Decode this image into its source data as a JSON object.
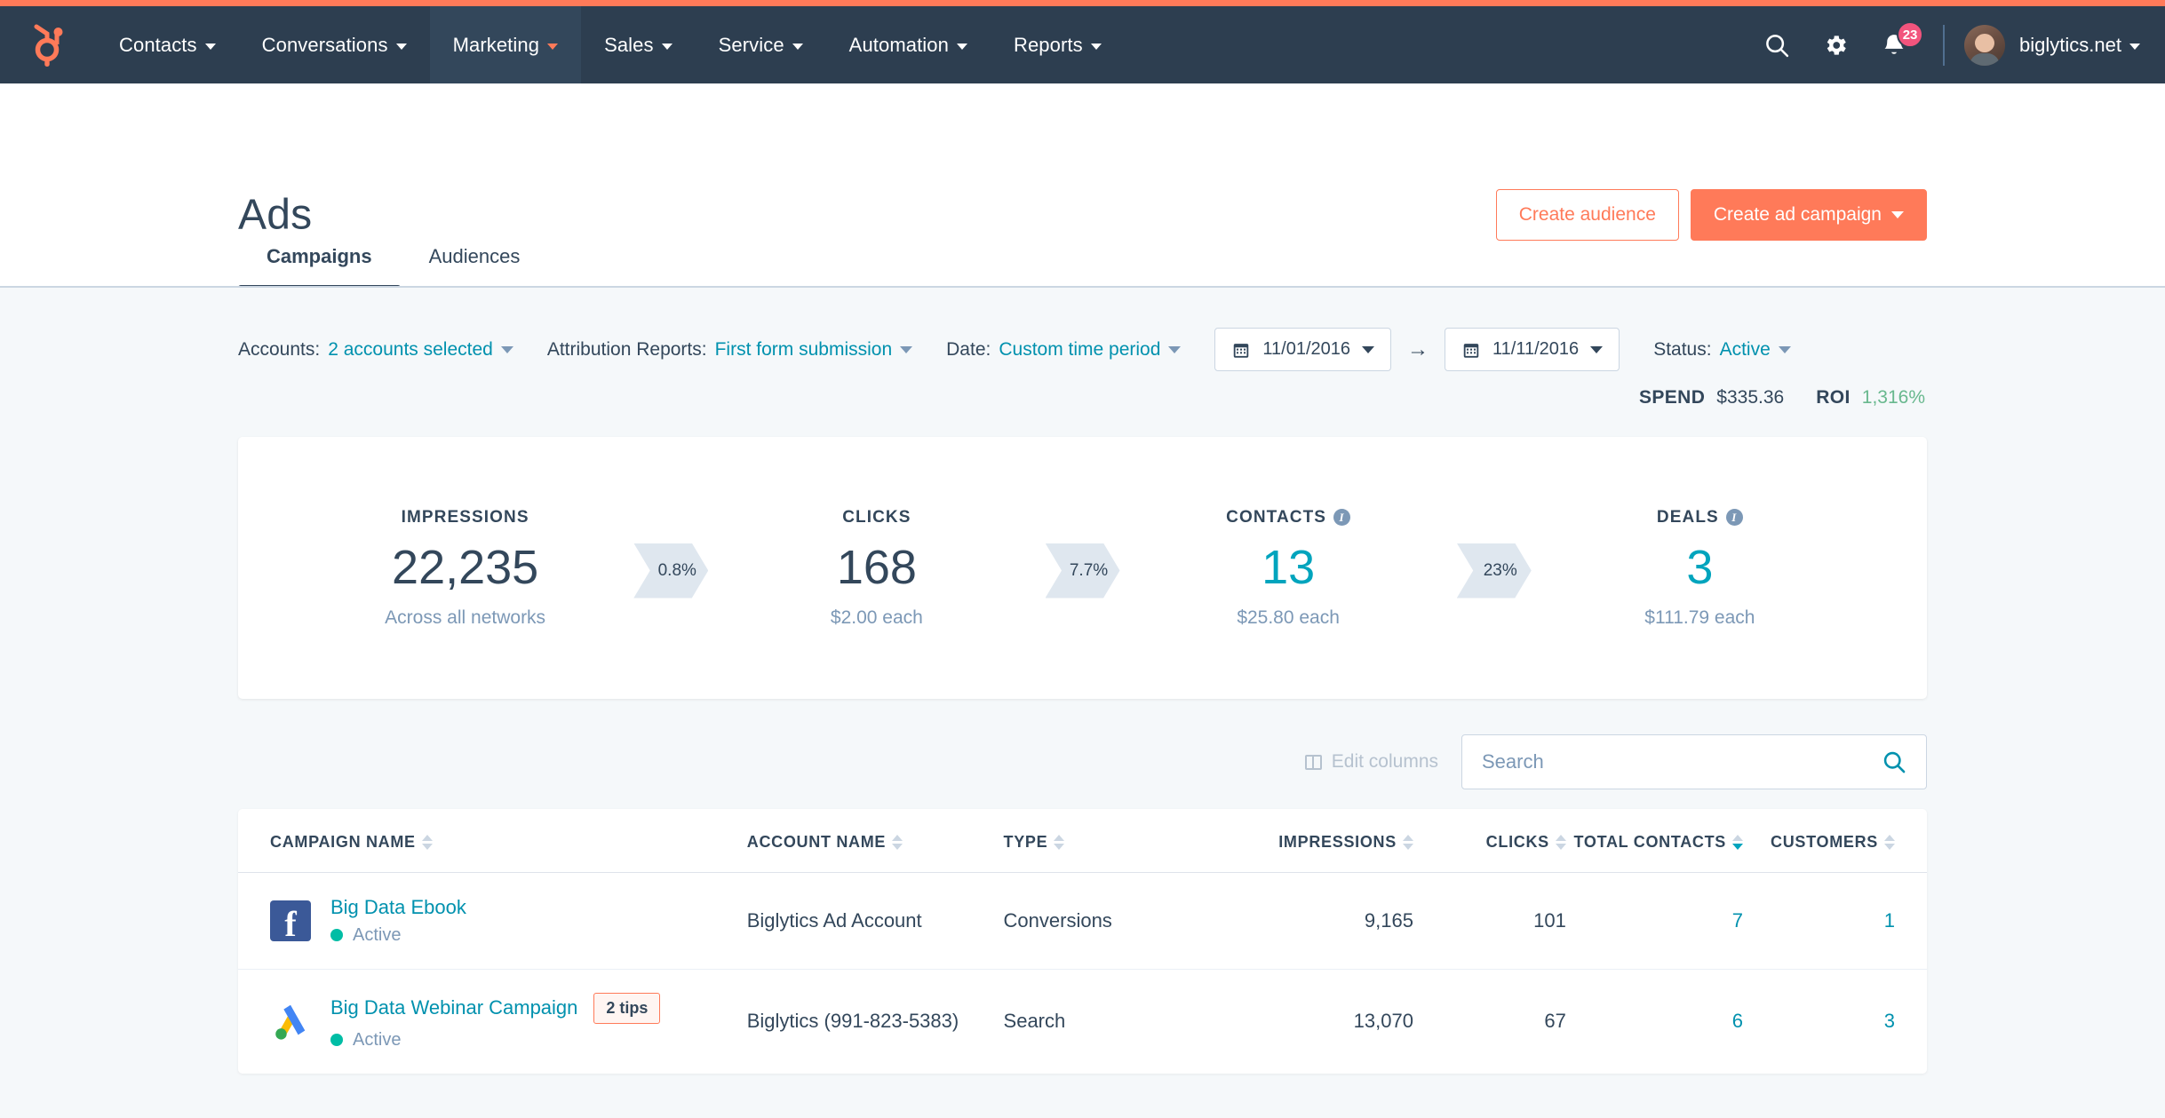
{
  "topnav": {
    "logo_icon": "hubspot-sprocket-logo",
    "items": [
      {
        "label": "Contacts",
        "active": false
      },
      {
        "label": "Conversations",
        "active": false
      },
      {
        "label": "Marketing",
        "active": true
      },
      {
        "label": "Sales",
        "active": false
      },
      {
        "label": "Service",
        "active": false
      },
      {
        "label": "Automation",
        "active": false
      },
      {
        "label": "Reports",
        "active": false
      }
    ],
    "search_icon": "search-icon",
    "settings_icon": "gear-icon",
    "notifications_icon": "bell-icon",
    "notification_count": "23",
    "account_name": "biglytics.net"
  },
  "header": {
    "title": "Ads",
    "create_audience_label": "Create audience",
    "create_campaign_label": "Create ad campaign",
    "tabs": [
      {
        "label": "Campaigns",
        "active": true
      },
      {
        "label": "Audiences",
        "active": false
      }
    ]
  },
  "filters": {
    "accounts_label": "Accounts:",
    "accounts_value": "2 accounts selected",
    "attribution_label": "Attribution Reports:",
    "attribution_value": "First form submission",
    "date_label": "Date:",
    "date_value": "Custom time period",
    "date_start": "11/01/2016",
    "date_end": "11/11/2016",
    "date_arrow": "→",
    "status_label": "Status:",
    "status_value": "Active"
  },
  "summary": {
    "spend_label": "SPEND",
    "spend_value": "$335.36",
    "roi_label": "ROI",
    "roi_value": "1,316%",
    "roi_color": "#68b88e"
  },
  "funnel": {
    "impressions": {
      "label": "IMPRESSIONS",
      "value": "22,235",
      "sub": "Across all networks"
    },
    "rate1": "0.8%",
    "clicks": {
      "label": "CLICKS",
      "value": "168",
      "sub": "$2.00 each"
    },
    "rate2": "7.7%",
    "contacts": {
      "label": "CONTACTS",
      "value": "13",
      "sub": "$25.80 each"
    },
    "rate3": "23%",
    "deals": {
      "label": "DEALS",
      "value": "3",
      "sub": "$111.79 each"
    }
  },
  "table_toolbar": {
    "edit_columns_label": "Edit columns",
    "search_placeholder": "Search",
    "search_value": ""
  },
  "table": {
    "columns": [
      {
        "label": "CAMPAIGN NAME",
        "sorted": false
      },
      {
        "label": "ACCOUNT NAME",
        "sorted": false
      },
      {
        "label": "TYPE",
        "sorted": false
      },
      {
        "label": "IMPRESSIONS",
        "sorted": false
      },
      {
        "label": "CLICKS",
        "sorted": false
      },
      {
        "label": "TOTAL CONTACTS",
        "sorted": true
      },
      {
        "label": "CUSTOMERS",
        "sorted": false
      }
    ],
    "rows": [
      {
        "network_icon": "facebook-icon",
        "campaign_name": "Big Data Ebook",
        "tips_badge": "",
        "status": "Active",
        "account_name": "Biglytics Ad Account",
        "type": "Conversions",
        "impressions": "9,165",
        "clicks": "101",
        "total_contacts": "7",
        "customers": "1"
      },
      {
        "network_icon": "google-ads-icon",
        "campaign_name": "Big Data Webinar Campaign",
        "tips_badge": "2 tips",
        "status": "Active",
        "account_name": "Biglytics (991-823-5383)",
        "type": "Search",
        "impressions": "13,070",
        "clicks": "67",
        "total_contacts": "6",
        "customers": "3"
      }
    ]
  }
}
